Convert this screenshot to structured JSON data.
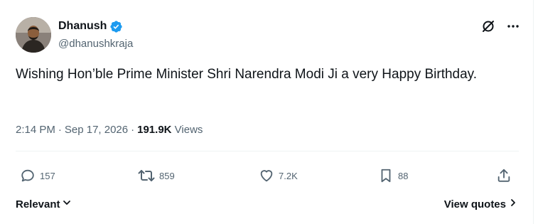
{
  "tweet": {
    "author": {
      "display_name": "Dhanush",
      "handle": "@dhanushkraja",
      "verified": true,
      "verified_color": "#1d9bf0"
    },
    "text": "Wishing Hon’ble Prime Minister Shri Narendra Modi Ji a very Happy Birthday.",
    "time": "2:14 PM",
    "separator": "·",
    "date": "Sep 17, 2026",
    "views_count": "191.9K",
    "views_label": "Views"
  },
  "top_actions": {
    "grok_icon": "circle-slash-icon",
    "more_icon": "ellipsis-icon"
  },
  "actions": {
    "reply": {
      "icon": "reply-icon",
      "count": "157"
    },
    "retweet": {
      "icon": "retweet-icon",
      "count": "859"
    },
    "like": {
      "icon": "heart-icon",
      "count": "7.2K"
    },
    "bookmark": {
      "icon": "bookmark-icon",
      "count": "88"
    },
    "share": {
      "icon": "share-icon"
    }
  },
  "footer": {
    "sort_label": "Relevant",
    "view_quotes_label": "View quotes"
  },
  "colors": {
    "text_primary": "#0f1419",
    "text_secondary": "#536471",
    "divider": "#eff3f4"
  }
}
